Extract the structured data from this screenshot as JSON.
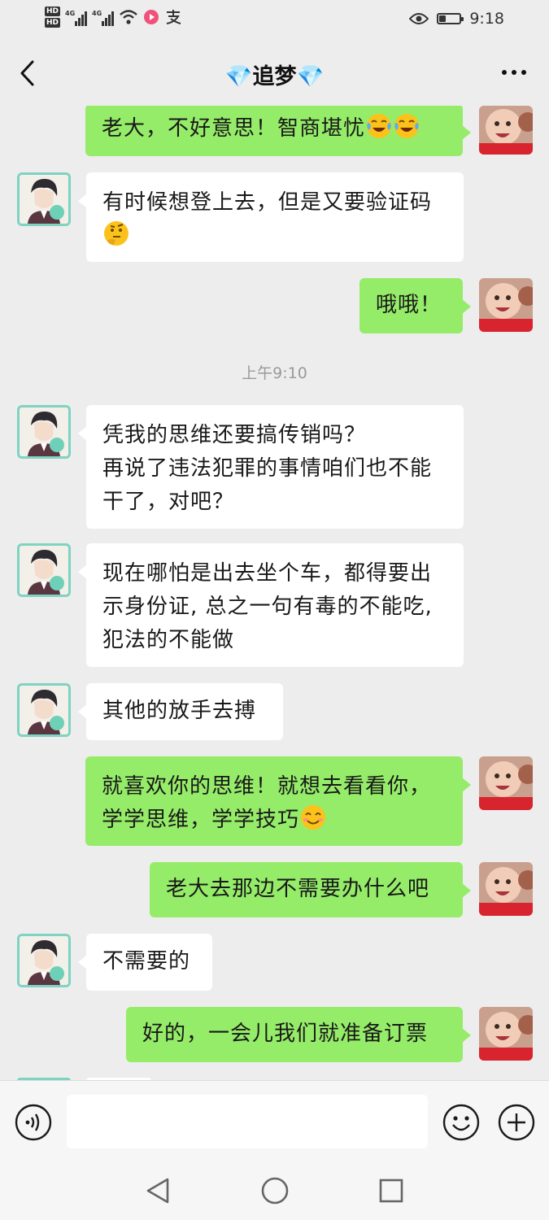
{
  "status_bar": {
    "hd1": "HD",
    "hd2": "HD",
    "net1": "4G",
    "net2": "4G",
    "time": "9:18",
    "battery_level": 0.3
  },
  "header": {
    "title": "💎追梦💎"
  },
  "colors": {
    "background": "#ededed",
    "incoming_bubble": "#ffffff",
    "outgoing_bubble": "#95ec69",
    "timestamp_text": "#9a9a9a"
  },
  "messages": [
    {
      "side": "out",
      "text": "老大，不好意思！智商堪忧",
      "emoji": "tears-of-joy-emoji ×2"
    },
    {
      "side": "in",
      "text": "有时候想登上去，但是又要验证码",
      "emoji": "thinking-face-emoji"
    },
    {
      "side": "out",
      "text": "哦哦！"
    },
    {
      "timestamp": "上午9:10"
    },
    {
      "side": "in",
      "line1": "凭我的思维还要搞传销吗？",
      "line2": "再说了违法犯罪的事情咱们也不能",
      "line3": "干了，对吧？"
    },
    {
      "side": "in",
      "line1": "现在哪怕是出去坐个车，都得要出",
      "line2": "示身份证, 总之一句有毒的不能吃,",
      "line3": "犯法的不能做"
    },
    {
      "side": "in",
      "text": "其他的放手去搏"
    },
    {
      "side": "out",
      "line1": "就喜欢你的思维！就想去看看你，",
      "line2": "学学思维，学学技巧",
      "emoji": "smiling-face-emoji"
    },
    {
      "side": "out",
      "text": "老大去那边不需要办什么吧"
    },
    {
      "side": "in",
      "text": "不需要的"
    },
    {
      "side": "out",
      "text": "好的，一会儿我们就准备订票"
    }
  ],
  "input_bar": {
    "voice_icon": "voice-icon",
    "emoji_icon": "emoji-face-icon",
    "plus_icon": "plus-icon",
    "text_value": ""
  },
  "nav_bar": {
    "back": "nav-back-icon",
    "home": "nav-home-icon",
    "recents": "nav-recents-icon"
  }
}
